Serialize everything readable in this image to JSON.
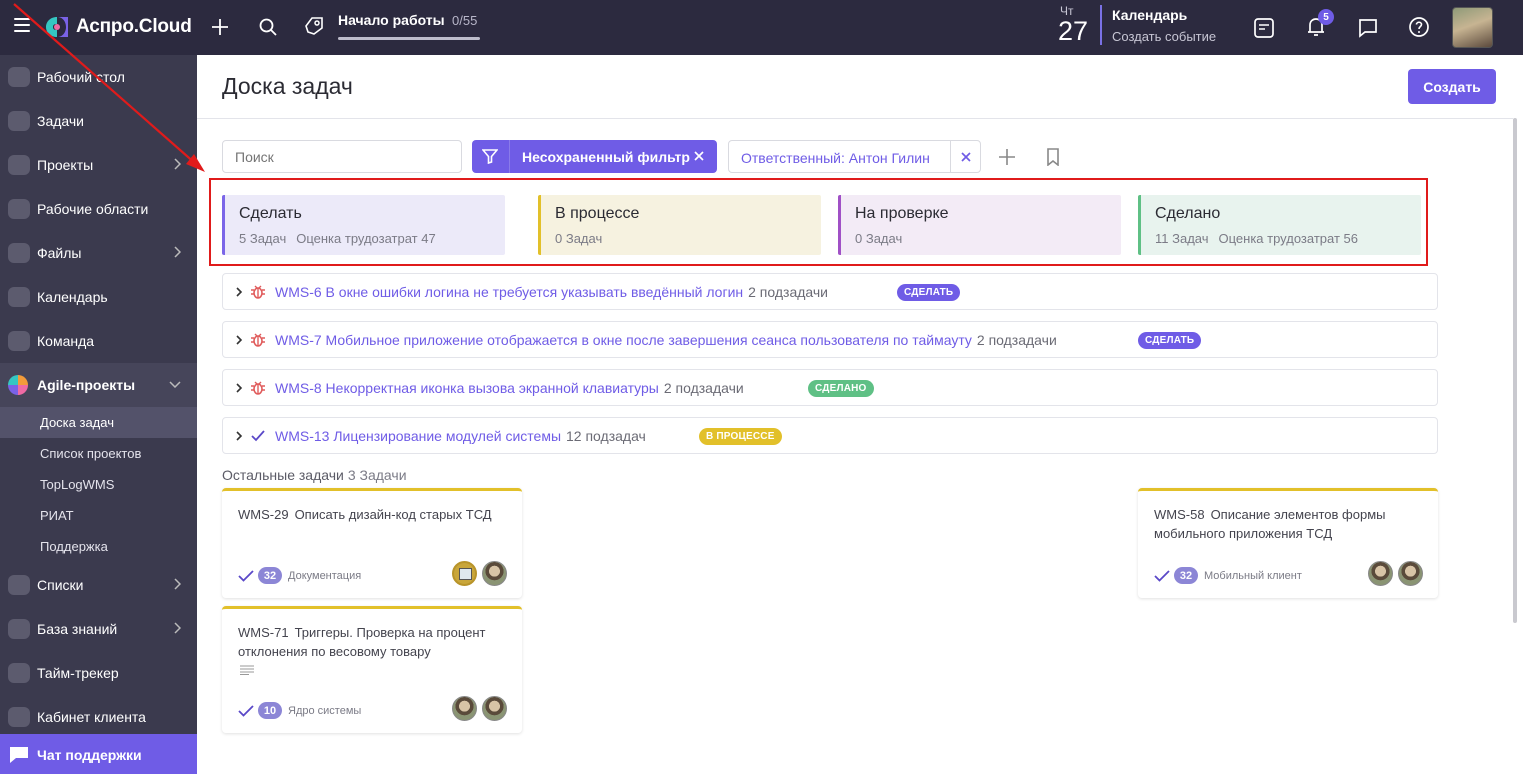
{
  "topbar": {
    "logo": "Аспро.Cloud",
    "onboarding_title": "Начало работы",
    "onboarding_count": "0/55",
    "onboarding_progress": 0.0,
    "day_name": "Чт",
    "day_number": "27",
    "calendar_title": "Календарь",
    "calendar_link": "Создать событие",
    "notifications_count": "5"
  },
  "sidebar": {
    "items": [
      {
        "label": "Рабочий стол"
      },
      {
        "label": "Задачи"
      },
      {
        "label": "Проекты"
      },
      {
        "label": "Рабочие области"
      },
      {
        "label": "Файлы"
      },
      {
        "label": "Календарь"
      },
      {
        "label": "Команда"
      },
      {
        "label": "Agile-проекты"
      },
      {
        "label": "Списки"
      },
      {
        "label": "База знаний"
      },
      {
        "label": "Тайм-трекер"
      },
      {
        "label": "Кабинет клиента"
      }
    ],
    "subitems": [
      {
        "label": "Доска задач"
      },
      {
        "label": "Список проектов"
      },
      {
        "label": "TopLogWMS"
      },
      {
        "label": "РИАТ"
      },
      {
        "label": "Поддержка"
      }
    ],
    "chat_support": "Чат поддержки"
  },
  "page": {
    "title": "Доска задач",
    "create_button": "Создать"
  },
  "filters": {
    "search_placeholder": "Поиск",
    "unsaved_filter": "Несохраненный фильтр",
    "assignee": "Ответственный: Антон Гилин"
  },
  "columns": [
    {
      "title": "Сделать",
      "count": "5 Задач",
      "estimate": "Оценка трудозатрат 47",
      "color": "#7b66e8"
    },
    {
      "title": "В процессе",
      "count": "0 Задач",
      "estimate": "",
      "color": "#e2c02a"
    },
    {
      "title": "На проверке",
      "count": "0 Задач",
      "estimate": "",
      "color": "#a050c6"
    },
    {
      "title": "Сделано",
      "count": "11 Задач",
      "estimate": "Оценка трудозатрат 56",
      "color": "#5fc085"
    }
  ],
  "epics": [
    {
      "title": "WMS-6 В окне ошибки логина не требуется указывать введённый логин",
      "subtasks": "2 подзадачи",
      "status": "СДЕЛАТЬ",
      "icon": "bug-icon"
    },
    {
      "title": "WMS-7 Мобильное приложение отображается в окне после завершения сеанса пользователя по таймауту",
      "subtasks": "2 подзадачи",
      "status": "СДЕЛАТЬ",
      "icon": "bug-icon"
    },
    {
      "title": "WMS-8 Некорректная иконка вызова экранной клавиатуры",
      "subtasks": "2 подзадачи",
      "status": "СДЕЛАНО",
      "icon": "bug-icon"
    },
    {
      "title": "WMS-13 Лицензирование модулей системы",
      "subtasks": "12 подзадач",
      "status": "В ПРОЦЕССЕ",
      "icon": "check-icon"
    }
  ],
  "others": {
    "title": "Остальные задачи",
    "count": "3 Задачи"
  },
  "cards": [
    {
      "key": "WMS-29",
      "title": "Описать дизайн-код старых ТСД",
      "estimate": "32",
      "component": "Документация"
    },
    {
      "key": "WMS-71",
      "title": "Триггеры. Проверка на процент отклонения по весовому товару",
      "estimate": "10",
      "component": "Ядро системы"
    },
    {
      "key": "WMS-58",
      "title": "Описание элементов формы мобильного приложения ТСД",
      "estimate": "32",
      "component": "Мобильный клиент"
    }
  ],
  "colors": {
    "accent": "#6f5ce6",
    "topbar": "#2c2a3f",
    "sidebar": "#3b3a4e",
    "annotation": "#e01b1b"
  }
}
